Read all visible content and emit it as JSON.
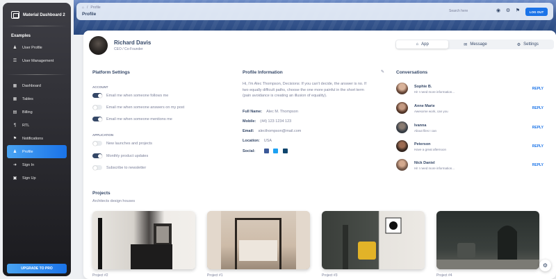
{
  "brand": {
    "name": "Material Dashboard 2"
  },
  "sidebar": {
    "section_title": "Examples",
    "top_items": [
      {
        "label": "User Profile",
        "icon": "user-icon"
      },
      {
        "label": "User Management",
        "icon": "list-icon"
      }
    ],
    "items": [
      {
        "label": "Dashboard",
        "icon": "dashboard-icon"
      },
      {
        "label": "Tables",
        "icon": "table-icon"
      },
      {
        "label": "Billing",
        "icon": "receipt-icon"
      },
      {
        "label": "RTL",
        "icon": "rtl-icon"
      },
      {
        "label": "Notifications",
        "icon": "bell-icon"
      },
      {
        "label": "Profile",
        "icon": "person-icon",
        "active": true
      },
      {
        "label": "Sign In",
        "icon": "login-icon"
      },
      {
        "label": "Sign Up",
        "icon": "assignment-icon"
      }
    ],
    "upgrade_label": "UPGRADE TO PRO"
  },
  "topbar": {
    "crumb_sep": "/",
    "crumb_page": "Profile",
    "title": "Profile",
    "search_placeholder": "Search here",
    "logout_label": "LOG OUT"
  },
  "profile": {
    "name": "Richard Davis",
    "role": "CEO / Co-Founder"
  },
  "tabs": [
    {
      "label": "App",
      "icon": "home-icon"
    },
    {
      "label": "Message",
      "icon": "email-icon"
    },
    {
      "label": "Settings",
      "icon": "settings-icon"
    }
  ],
  "platform": {
    "title": "Platform Settings",
    "account_head": "ACCOUNT",
    "account": [
      {
        "label": "Email me when someone follows me",
        "on": true
      },
      {
        "label": "Email me when someone answers on my post",
        "on": false
      },
      {
        "label": "Email me when someone mentions me",
        "on": true
      }
    ],
    "application_head": "APPLICATION",
    "application": [
      {
        "label": "New launches and projects",
        "on": false
      },
      {
        "label": "Monthly product updates",
        "on": true
      },
      {
        "label": "Subscribe to newsletter",
        "on": false
      }
    ]
  },
  "info": {
    "title": "Profile Information",
    "bio": "Hi, I'm Alec Thompson, Decisions: If you can't decide, the answer is no. If two equally difficult paths, choose the one more painful in the short term (pain avoidance is creating an illusion of equality).",
    "rows": [
      {
        "label": "Full Name:",
        "value": "Alec M. Thompson"
      },
      {
        "label": "Mobile:",
        "value": "(44) 123 1234 123"
      },
      {
        "label": "Email:",
        "value": "alecthompson@mail.com"
      },
      {
        "label": "Location:",
        "value": "USA"
      }
    ],
    "social_label": "Social:",
    "social": [
      {
        "icon": "facebook-icon",
        "color": "#3b5998"
      },
      {
        "icon": "twitter-icon",
        "color": "#1da1f2"
      },
      {
        "icon": "instagram-icon",
        "color": "#0e456d"
      }
    ]
  },
  "conversations": {
    "title": "Conversations",
    "reply_label": "REPLY",
    "items": [
      {
        "name": "Sophie B.",
        "msg": "Hi! I need more information..."
      },
      {
        "name": "Anne Marie",
        "msg": "Awesome work, can you"
      },
      {
        "name": "Ivanna",
        "msg": "About files I can"
      },
      {
        "name": "Peterson",
        "msg": "Have a great afternoon"
      },
      {
        "name": "Nick Daniel",
        "msg": "Hi! I need more information..."
      }
    ]
  },
  "projects": {
    "title": "Projects",
    "subtitle": "Architects design houses",
    "items": [
      {
        "caption": "Project #2"
      },
      {
        "caption": "Project #1"
      },
      {
        "caption": "Project #3"
      },
      {
        "caption": "Project #4"
      }
    ]
  },
  "colors": {
    "accent": "#1a73e8",
    "dark": "#344767",
    "muted": "#7b809a"
  }
}
